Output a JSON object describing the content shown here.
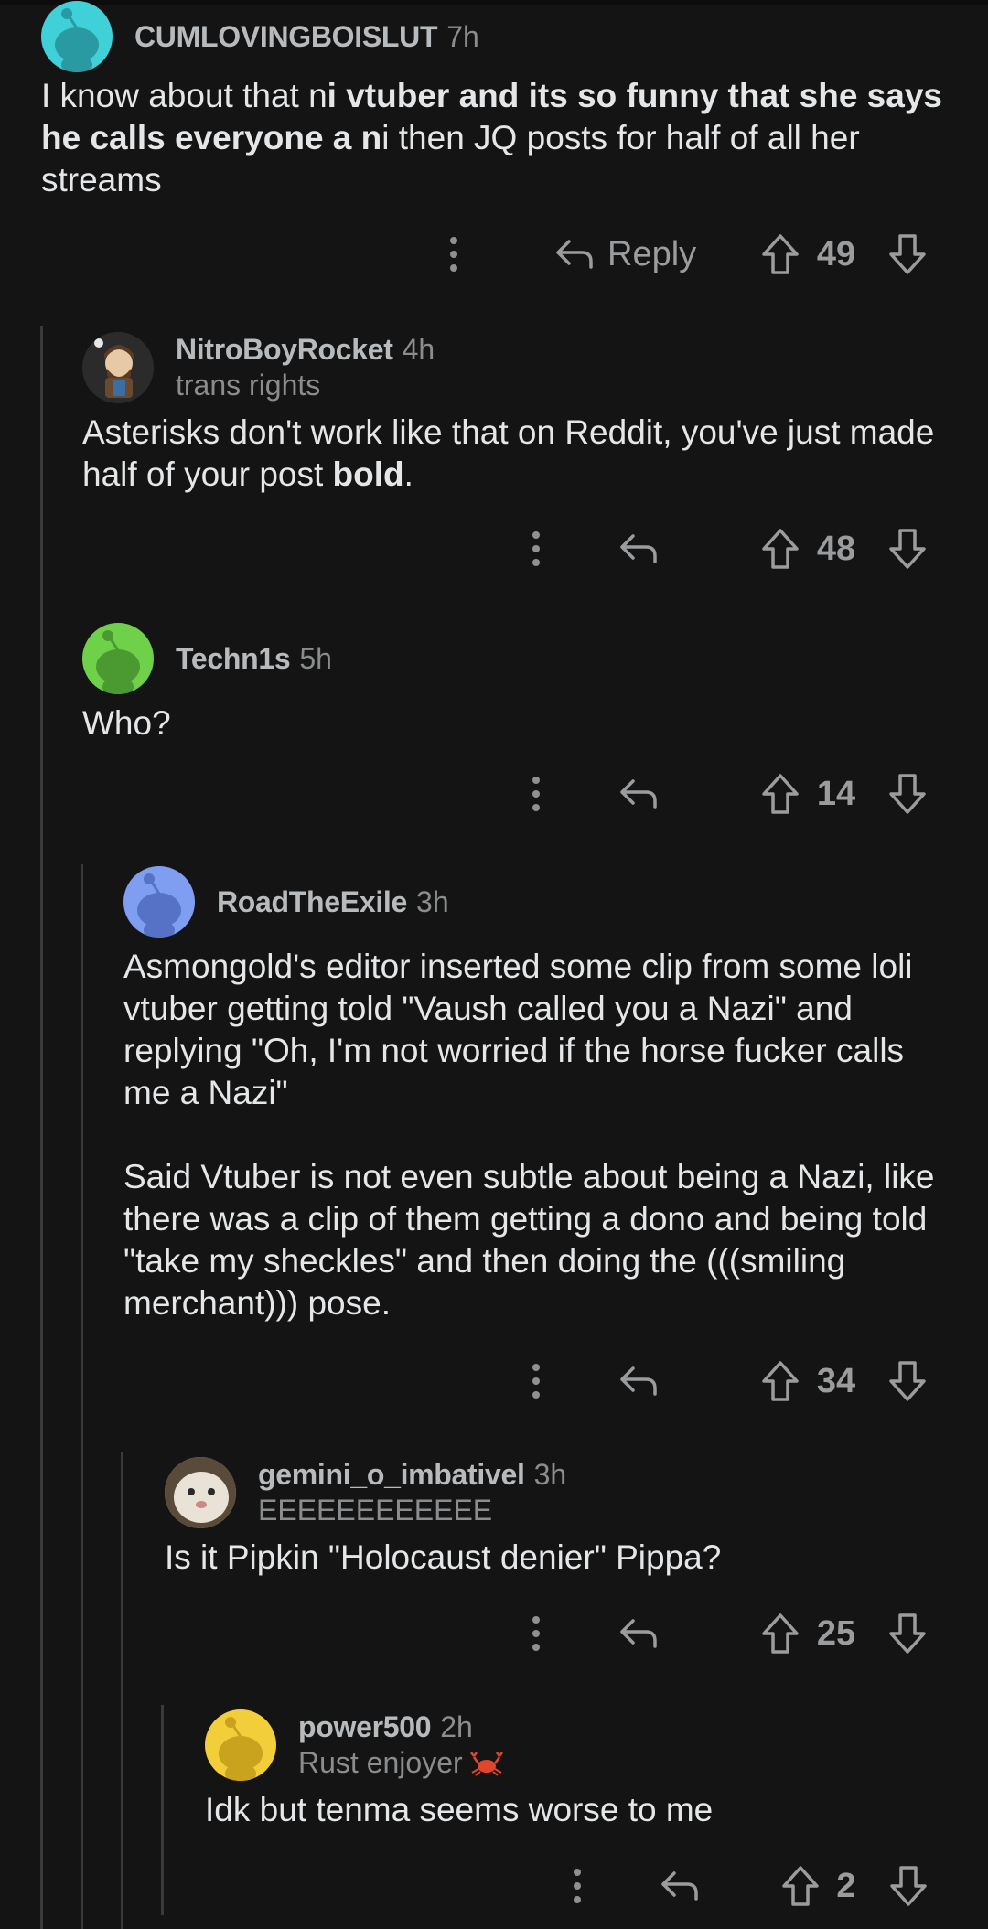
{
  "comments": [
    {
      "username": "CUMLOVINGBOISLUT",
      "age": "7h",
      "flair": "",
      "avatar_color": "#3fd0d8",
      "body_html": "I know about that n<b>i vtuber and its so funny that she says he calls everyone a n</b>i then JQ posts for half of all her streams",
      "reply_label": "Reply",
      "score": "49"
    },
    {
      "username": "NitroBoyRocket",
      "age": "4h",
      "flair": "trans rights",
      "avatar_color": "#2a2a2a",
      "body_html": "Asterisks don't work like that on Reddit, you've just made half of your post <b>bold</b>.",
      "score": "48"
    },
    {
      "username": "Techn1s",
      "age": "5h",
      "flair": "",
      "avatar_color": "#6fd14a",
      "body_html": "Who?",
      "score": "14"
    },
    {
      "username": "RoadTheExile",
      "age": "3h",
      "flair": "",
      "avatar_color": "#7f9ef2",
      "body_p1": "Asmongold's editor inserted some clip from some loli vtuber getting told \"Vaush called you a Nazi\" and replying \"Oh, I'm not worried if the horse fucker calls me a Nazi\"",
      "body_p2": "Said Vtuber is not even subtle about being a Nazi, like there was a clip of them getting a dono and being told \"take my sheckles\" and then doing the (((smiling merchant))) pose.",
      "score": "34"
    },
    {
      "username": "gemini_o_imbativel",
      "age": "3h",
      "flair": "EEEEEEEEEEEE",
      "avatar_color": "#d9d2c4",
      "body_html": "Is it Pipkin \"Holocaust denier\" Pippa?",
      "score": "25"
    },
    {
      "username": "power500",
      "age": "2h",
      "flair": "Rust enjoyer",
      "flair_icon": "crab-icon",
      "avatar_color": "#f2cf3a",
      "body_html": "Idk but tenma seems worse to me",
      "score": "2"
    }
  ],
  "icons": {
    "more": "more-options-icon",
    "reply": "reply-arrow-icon",
    "upvote": "upvote-icon",
    "downvote": "downvote-icon"
  },
  "colors": {
    "background": "#141414",
    "text": "#e4e6e8",
    "muted": "#8a8c8e",
    "thread_line": "#3a3a3a"
  }
}
